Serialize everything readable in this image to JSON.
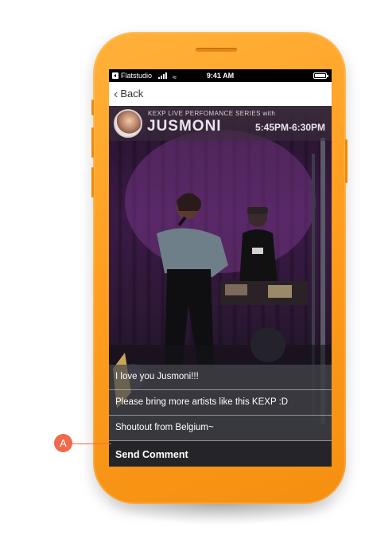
{
  "status_bar": {
    "carrier": "Flatstudio",
    "time": "9:41 AM"
  },
  "nav": {
    "back_label": "Back"
  },
  "header": {
    "series_label": "KEXP LIVE PERFOMANCE SERIES with",
    "artist": "JUSMONI",
    "time_range": "5:45PM-6:30PM"
  },
  "comments": [
    "I love you Jusmoni!!!",
    "Please bring more artists like this KEXP :D",
    "Shoutout from Belgium~"
  ],
  "send_comment_label": "Send Comment",
  "callout": {
    "label": "A"
  },
  "colors": {
    "phone_body": "#ff9e1f",
    "callout": "#f16a4b"
  }
}
